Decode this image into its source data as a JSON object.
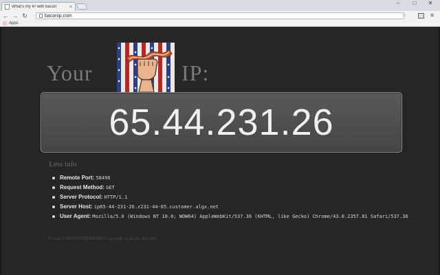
{
  "browser": {
    "tab_title": "What's my IP with bacon",
    "tab_close": "×",
    "url": "baconip.com",
    "bookmarks_apps": "Apps",
    "window_min": "–",
    "window_max": "□",
    "window_close": "✕",
    "back": "←",
    "forward": "→",
    "reload": "↻",
    "star": "☆",
    "menu": "≡"
  },
  "page": {
    "heading_left": "Your",
    "heading_right": "IP:",
    "ip_address": "65.44.231.26",
    "less_info": "Less info",
    "details": [
      {
        "label": "Remote Port:",
        "value": "58496"
      },
      {
        "label": "Request Method:",
        "value": "GET"
      },
      {
        "label": "Server Protocol:",
        "value": "HTTP/1.1"
      },
      {
        "label": "Server Host:",
        "value": "ip65-44-231-26.z231-44-65.customer.algx.net"
      },
      {
        "label": "User Agent:",
        "value": "Mozilla/5.0 (Windows NT 10.0; WOW64) AppleWebKit/537.36 (KHTML, like Gecko) Chrome/43.0.2357.81 Safari/537.36"
      }
    ],
    "timing": "It took 0.00018715858459473 seconds to sizzle this info."
  },
  "colors": {
    "page_background": "#262626",
    "ip_box": "#505050",
    "logo_stripe_red": "#c8302a",
    "logo_blue": "#2a3e8c"
  }
}
